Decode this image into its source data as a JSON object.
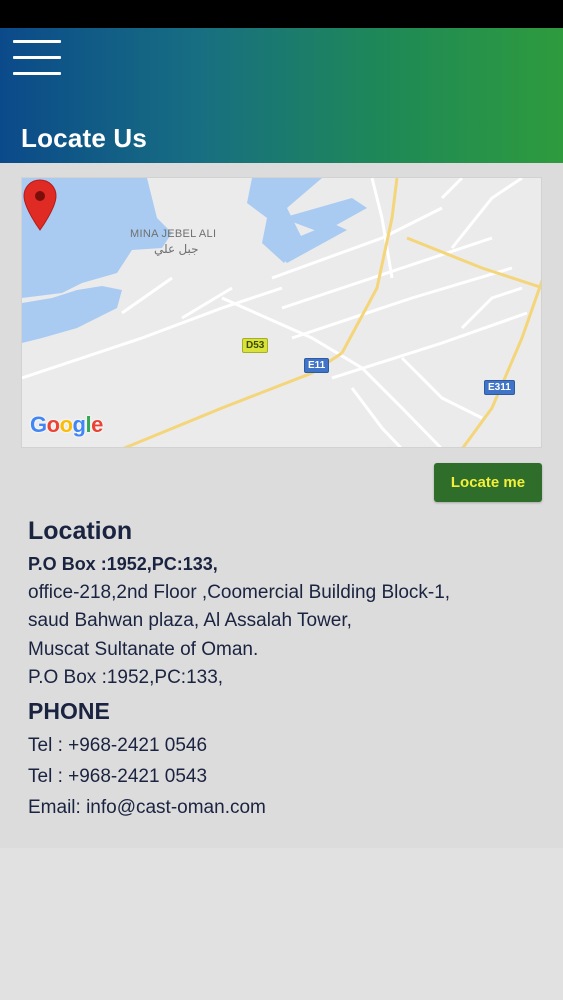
{
  "header": {
    "title": "Locate Us",
    "menu_icon": "hamburger-icon"
  },
  "map": {
    "place_label": "MINA JEBEL ALI",
    "place_label_ar": "جبل علي",
    "roads": [
      "D53",
      "E11",
      "E311"
    ],
    "logo_text": "Google",
    "pin_icon": "map-pin-icon"
  },
  "actions": {
    "locate_me_label": "Locate me"
  },
  "location": {
    "title": "Location",
    "po_box_bold": "P.O Box :1952,PC:133,",
    "address_lines": [
      "office-218,2nd Floor ,Coomercial Building Block-1,",
      "saud Bahwan plaza, Al Assalah Tower,",
      "Muscat Sultanate of Oman.",
      "P.O Box :1952,PC:133,"
    ]
  },
  "phone": {
    "title": "PHONE",
    "tel_1": "Tel : +968-2421 0546",
    "tel_2": "Tel : +968-2421 0543",
    "email": "Email: info@cast-oman.com"
  },
  "colors": {
    "header_start": "#0b4a8a",
    "header_end": "#2e9b3e",
    "button_bg": "#2e6e2a",
    "button_text": "#f4f03a",
    "text": "#1a2340",
    "pin": "#e02a24"
  }
}
